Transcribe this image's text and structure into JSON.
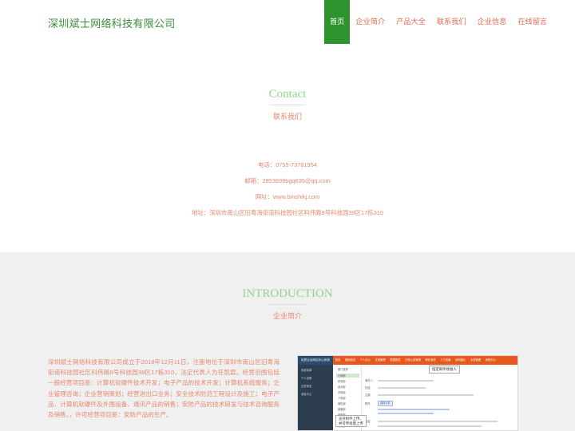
{
  "header": {
    "brand": "深圳斌士网络科技有限公司",
    "nav": [
      {
        "label": "首页",
        "active": true
      },
      {
        "label": "企业简介",
        "active": false
      },
      {
        "label": "产品大全",
        "active": false
      },
      {
        "label": "联系我们",
        "active": false
      },
      {
        "label": "企业信息",
        "active": false
      },
      {
        "label": "在线留言",
        "active": false
      }
    ]
  },
  "contact": {
    "title": "Contact",
    "subtitle": "联系我们",
    "phone": "电话：0755-73781954",
    "email": "邮箱：2853699bgq635@qq.com",
    "website": "网址：www.binshikj.com",
    "address": "地址：深圳市南山区旧粤海街道科技园社区科伟路9号科技园39区17栋310"
  },
  "intro": {
    "title": "INTRODUCTION",
    "subtitle": "企业简介",
    "text": "深圳斌士网络科技有限公司成立于2018年12月11日，注册地位于深圳市南山区旧粤海街道科技园社区科伟路9号科技园39区17栋310，法定代表人为任凯宸。经营范围包括一般经营项目是：计算机软硬件技术开发；电子产品的技术开发；计算机系统服务；企业管理咨询；企业营销策划；经营进出口业务；安全技术防范工程设计及施工；电子产品、计算机软硬件及外围设备、通讯产品的销售；安防产品的技术研发与技术咨询服务及销售。，许可经营项目是：安防产品的生产。"
  },
  "screenshot": {
    "brand": "优质企业网站中心系统",
    "menu": [
      "首页",
      "基础信息",
      "个人办公",
      "文档管理",
      "数据报表",
      "日常公务管理",
      "邮件系统",
      "人力资源",
      "资料图片",
      "业务管理",
      "系统中心"
    ],
    "side": [
      "系统菜单",
      "个人设置",
      "日常事务",
      "消息中心"
    ],
    "tree": [
      "部门选择",
      "行政部",
      "财务部",
      "技术部",
      "市场部",
      "人事部",
      "销售部",
      "客服部",
      "采购部",
      "后勤部",
      "仓储部"
    ],
    "labels": [
      "收件人",
      "抄送",
      "主题",
      "附件",
      "内容"
    ],
    "button": "选择文件",
    "callout_top": "指定邮件接收人",
    "callout_bottom_1": "支持附件上传，",
    "callout_bottom_2": "并可传批量上传"
  },
  "colors": {
    "brand_green": "#3a8a3a",
    "nav_active_bg": "#2e922e",
    "accent_orange": "#e06a52",
    "title_green": "#8fd68f",
    "intro_bg": "#f0f0f0"
  }
}
